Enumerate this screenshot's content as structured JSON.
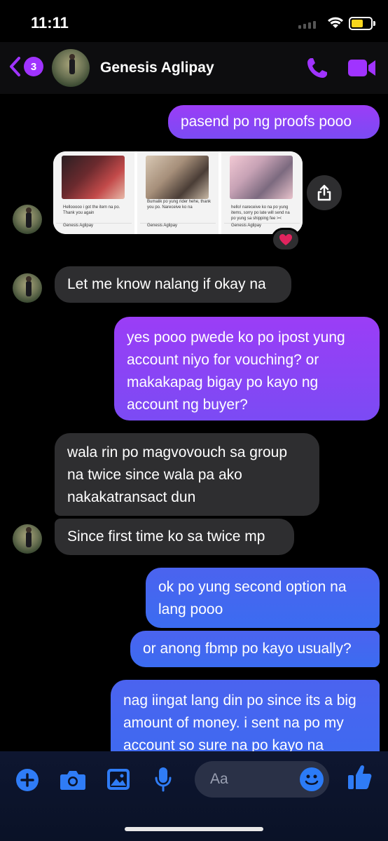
{
  "status_bar": {
    "time": "11:11"
  },
  "header": {
    "unread_count": "3",
    "contact_name": "Genesis Aglipay"
  },
  "messages": {
    "m1": "pasend po ng proofs pooo",
    "m2": "Let me know nalang if okay na",
    "m3": "yes pooo pwede ko po ipost yung account niyo for vouching? or makakapag bigay po kayo ng account ng buyer?",
    "m4": "wala rin po magvovouch sa group na twice since wala pa ako nakakatransact dun",
    "m5": "Since first time ko sa twice mp",
    "m6": "ok po yung second option na lang pooo",
    "m7": "or anong fbmp po kayo usually?",
    "m8": "nag iingat lang din po since its a big amount of money. i sent na po my account so sure na po kayo na"
  },
  "photos": [
    {
      "caption": "Hellooooo i got the item na po. Thank you again",
      "footer": "Genesis Aglipay"
    },
    {
      "caption": "Bumalik po yung rider hehe, thank you po. Nareceive ko na",
      "footer": "Genesis Aglipay"
    },
    {
      "caption": "hello! nareceive ko na po yung items, sorry po late will send na po yung sa shipping fee ><",
      "footer": "Genesis Aglipay"
    }
  ],
  "reaction": "heart",
  "composer": {
    "placeholder": "Aa"
  },
  "colors": {
    "outgoing_purple": "#9b3df6",
    "outgoing_blue": "#3b6cf1",
    "incoming": "#2e2e30",
    "accent": "#a033ff"
  },
  "icons": [
    "back-chevron-icon",
    "phone-icon",
    "video-camera-icon",
    "share-icon",
    "heart-icon",
    "plus-icon",
    "camera-icon",
    "image-icon",
    "microphone-icon",
    "emoji-icon",
    "thumbs-up-icon"
  ]
}
